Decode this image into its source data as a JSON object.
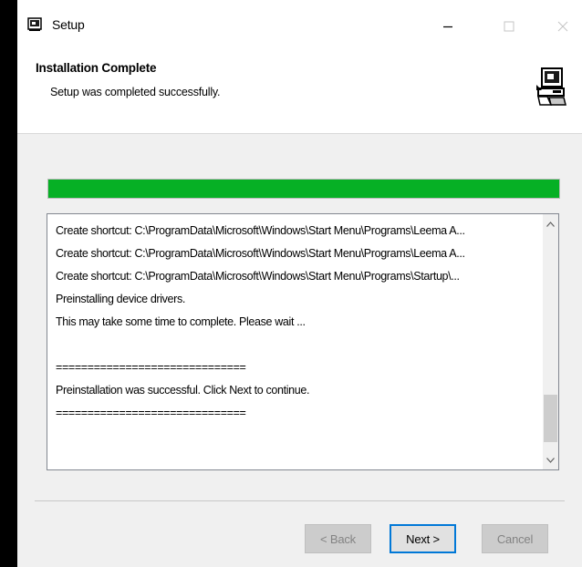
{
  "window": {
    "title": "Setup",
    "icon": "setup-app-icon",
    "controls": [
      "minimize-icon",
      "maximize-icon",
      "close-icon"
    ]
  },
  "header": {
    "title": "Installation Complete",
    "subtitle": "Setup was completed successfully.",
    "icon": "computer-install-icon"
  },
  "progress": {
    "value": 1.0,
    "color": "#06b025"
  },
  "log": {
    "lines": [
      "Create shortcut: C:\\ProgramData\\Microsoft\\Windows\\Start Menu\\Programs\\Leema A...",
      "Create shortcut: C:\\ProgramData\\Microsoft\\Windows\\Start Menu\\Programs\\Leema A...",
      "Create shortcut: C:\\ProgramData\\Microsoft\\Windows\\Start Menu\\Programs\\Startup\\...",
      "Preinstalling device drivers.",
      "This may take some time to complete. Please wait ...",
      "",
      "==============================",
      "Preinstallation was successful. Click Next to continue.",
      "=============================="
    ]
  },
  "buttons": {
    "back": "< Back",
    "next": "Next >",
    "cancel": "Cancel"
  },
  "colors": {
    "accent": "#0078d7",
    "progress": "#06b025",
    "background": "#f0f0f0"
  }
}
